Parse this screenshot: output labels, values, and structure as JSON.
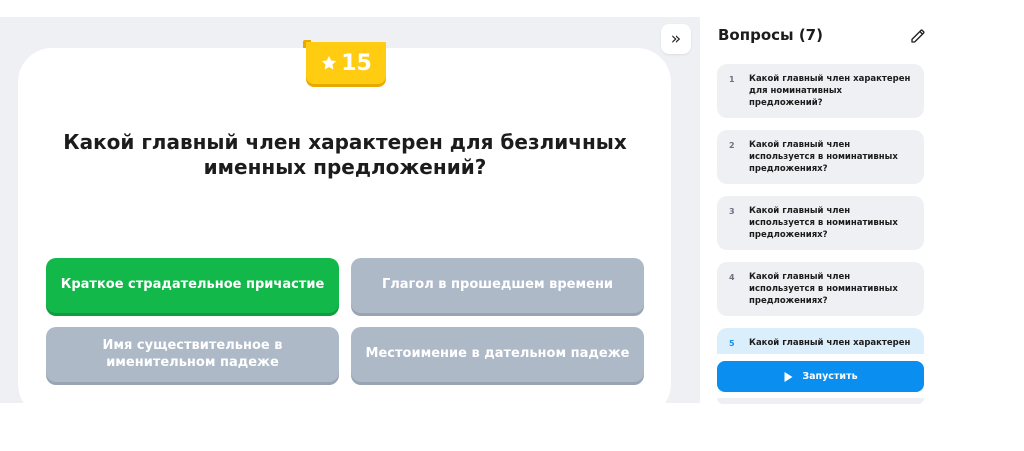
{
  "toolbar": {
    "collapse_label": "»"
  },
  "question": {
    "points": "15",
    "text": "Какой главный член характерен для безличных именных предложений?"
  },
  "answers": [
    {
      "label": "Краткое страдательное причастие",
      "status": "correct"
    },
    {
      "label": "Глагол в прошедшем времени",
      "status": "neutral"
    },
    {
      "label": "Имя существительное в именительном падеже",
      "status": "neutral"
    },
    {
      "label": "Местоимение в дательном падеже",
      "status": "neutral"
    }
  ],
  "sidebar": {
    "title": "Вопросы (7)",
    "items": [
      {
        "num": "1",
        "text": "Какой главный член характерен для номинативных предложений?"
      },
      {
        "num": "2",
        "text": "Какой главный член используется в номинативных предложениях?"
      },
      {
        "num": "3",
        "text": "Какой главный член используется в номинативных предложениях?"
      },
      {
        "num": "4",
        "text": "Какой главный член используется в номинативных предложениях?"
      },
      {
        "num": "5",
        "text": "Какой главный член характерен"
      }
    ],
    "run_label": "Запустить"
  },
  "colors": {
    "correct": "#12b84a",
    "neutral": "#aeb9c8",
    "accent": "#0a8ff0",
    "points": "#ffcc11"
  }
}
